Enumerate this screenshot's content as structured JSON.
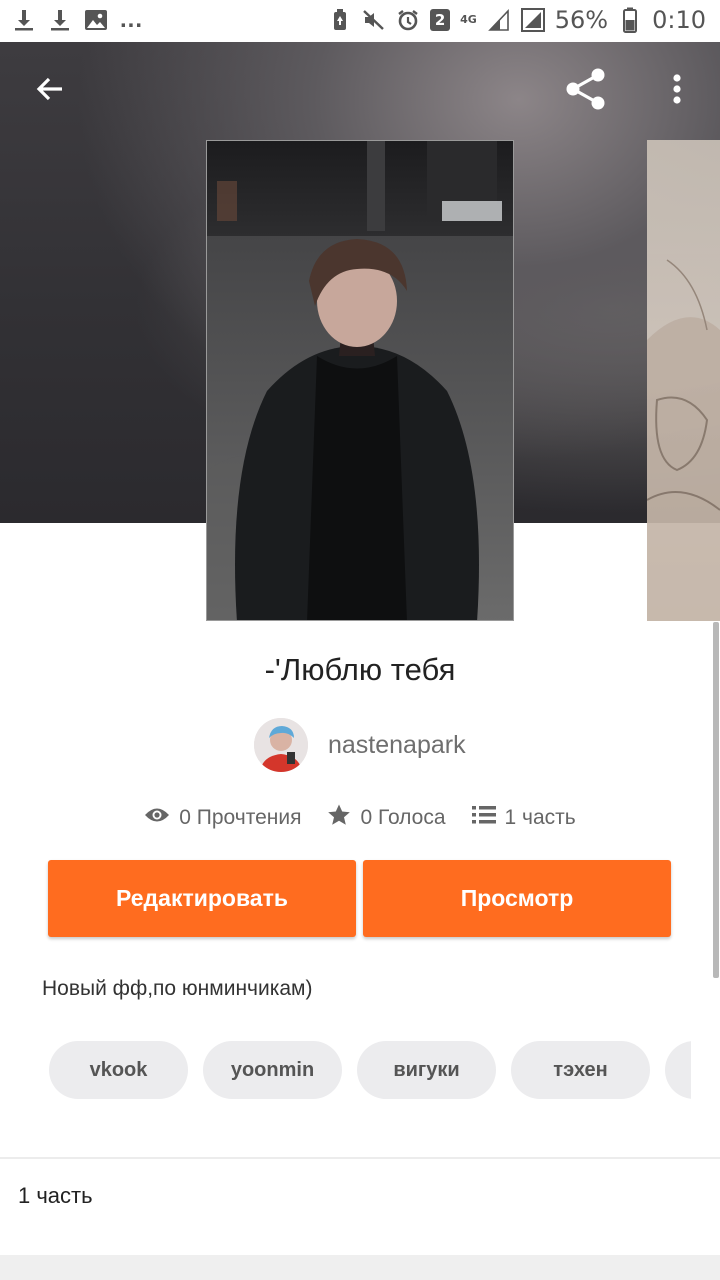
{
  "status_bar": {
    "left_icons": [
      "download-icon",
      "download-icon",
      "image-icon"
    ],
    "overflow": "...",
    "notification_badge": "2",
    "network": "4G",
    "battery": "56%",
    "time": "0:10"
  },
  "header": {
    "back_icon": "arrow-left-icon",
    "share_icon": "share-icon",
    "more_icon": "more-vertical-icon"
  },
  "story": {
    "title": "-'Люблю тебя",
    "author": "nastenapark",
    "reads": "0 Прочтения",
    "votes": "0 Голоса",
    "parts": "1 часть",
    "description": "Новый фф,по юнминчикам)"
  },
  "actions": {
    "edit_label": "Редактировать",
    "view_label": "Просмотр"
  },
  "tags": [
    "vkook",
    "yoonmin",
    "вигуки",
    "тэхен",
    ""
  ],
  "parts_list": {
    "label": "1 часть"
  },
  "colors": {
    "accent": "#ff6c1f",
    "hero_bg": "#333236",
    "tag_bg": "#ececee"
  }
}
